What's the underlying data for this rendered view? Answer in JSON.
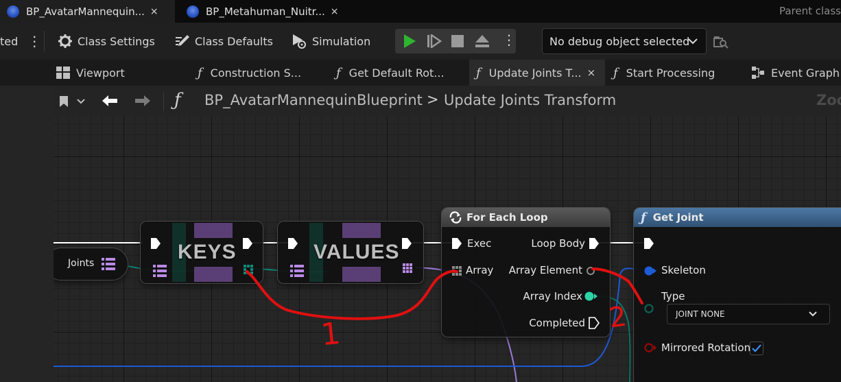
{
  "tabs": [
    {
      "label": "BP_AvatarMannequin...",
      "close": "×",
      "active": true
    },
    {
      "label": "BP_Metahuman_Nuitr...",
      "close": "×",
      "active": false
    }
  ],
  "parent_class_label": "Parent class",
  "toolbar": {
    "left_fragment": "ted",
    "class_settings": "Class Settings",
    "class_defaults": "Class Defaults",
    "simulation": "Simulation",
    "debug_select": "No debug object selected"
  },
  "graph_tabs": [
    {
      "label": "Viewport",
      "icon": "viewport-icon"
    },
    {
      "label": "Construction S...",
      "icon": "function-icon"
    },
    {
      "label": "Get Default Rot...",
      "icon": "function-icon"
    },
    {
      "label": "Update Joints T...",
      "icon": "function-icon",
      "close": "×",
      "active": true
    },
    {
      "label": "Start Processing",
      "icon": "function-icon"
    },
    {
      "label": "Event Graph",
      "icon": "event-graph-icon"
    }
  ],
  "breadcrumb": {
    "root": "BP_AvatarMannequinBlueprint",
    "separator": ">",
    "current": "Update Joints Transform",
    "zoom_fragment": "Zoo"
  },
  "nodes": {
    "joints_var": {
      "label": "Joints"
    },
    "keys": {
      "label": "KEYS"
    },
    "values": {
      "label": "VALUES"
    },
    "for_each": {
      "title": "For Each Loop",
      "exec": "Exec",
      "array": "Array",
      "loop_body": "Loop Body",
      "array_element": "Array Element",
      "array_index": "Array Index",
      "completed": "Completed"
    },
    "get_joint": {
      "title": "Get Joint",
      "skeleton": "Skeleton",
      "type": "Type",
      "type_value": "JOINT NONE",
      "mirrored_rotation": "Mirrored Rotation",
      "mirrored_checked": true
    }
  },
  "annotations": {
    "one": "1",
    "two": "2"
  },
  "colors": {
    "accent_blue": "#2f6fd6",
    "exec_white": "#ffffff",
    "array_purple": "#b98ae6",
    "int_teal": "#2ed3a5",
    "object_blue": "#1e5bd8",
    "enum_dark_teal": "#0d5a4e",
    "bool_red": "#8a0a0a",
    "annotation_red": "#e01010",
    "function_header": "#3b5f86",
    "macro_header": "#4a4a4a",
    "play_green": "#2fb52f"
  }
}
